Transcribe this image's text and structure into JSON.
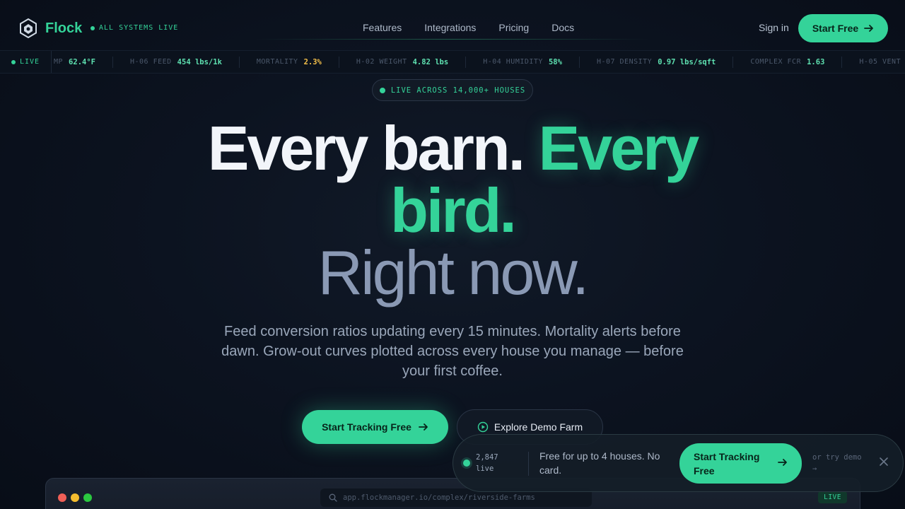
{
  "nav": {
    "brand": "Flock",
    "status": "ALL SYSTEMS LIVE",
    "links": [
      "Features",
      "Integrations",
      "Pricing",
      "Docs"
    ],
    "sign_in": "Sign in",
    "start_free": "Start Free"
  },
  "ticker": {
    "live_label": "LIVE",
    "items": [
      {
        "label": "MP",
        "value": "62.4°F",
        "status": "ok"
      },
      {
        "label": "H-06 FEED",
        "value": "454 lbs/1k",
        "status": "ok"
      },
      {
        "label": "MORTALITY",
        "value": "2.3%",
        "status": "warn"
      },
      {
        "label": "H-02 WEIGHT",
        "value": "4.82 lbs",
        "status": "ok"
      },
      {
        "label": "H-04 HUMIDITY",
        "value": "58%",
        "status": "ok"
      },
      {
        "label": "H-07 DENSITY",
        "value": "0.97 lbs/sqft",
        "status": "ok"
      },
      {
        "label": "COMPLEX FCR",
        "value": "1.63",
        "status": "ok"
      },
      {
        "label": "H-05 VENT",
        "value": "",
        "status": "ok"
      }
    ]
  },
  "hero": {
    "pill": "LIVE ACROSS 14,000+ HOUSES",
    "headline_a": "Every barn.",
    "headline_b": "Every",
    "headline_c": "bird.",
    "headline_d": "Right now.",
    "subtitle": "Feed conversion ratios updating every 15 minutes. Mortality alerts before dawn. Grow-out curves plotted across every house you manage — before your first coffee.",
    "cta_primary": "Start Tracking Free",
    "cta_secondary": "Explore Demo Farm"
  },
  "preview": {
    "url": "app.flockmanager.io/complex/riverside-farms",
    "live_badge": "LIVE"
  },
  "sticky_bar": {
    "live_count": "2,847",
    "live_word": "live",
    "text": "Free for up to 4 houses. No card.",
    "cta_line1": "Start Tracking",
    "cta_line2": "Free",
    "demo_line1": "or try demo",
    "demo_line2": "→"
  },
  "colors": {
    "accent": "#34d399",
    "warn": "#f5c04a",
    "background": "#0c1320"
  }
}
